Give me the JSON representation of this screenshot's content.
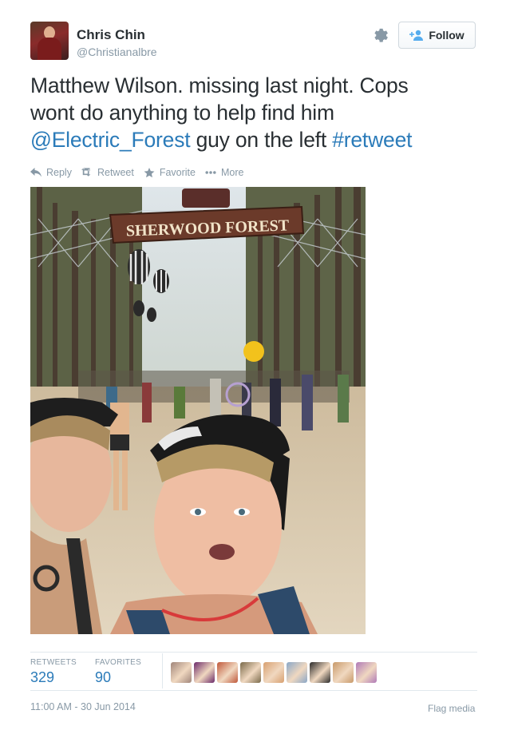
{
  "author": {
    "name": "Chris Chin",
    "handle": "@Christianalbre"
  },
  "follow_label": "Follow",
  "tweet": {
    "line1": "Matthew Wilson. missing last night. Cops",
    "line2": "wont do anything to help find him",
    "mention": "@Electric_Forest",
    "middle": " guy on the left ",
    "hashtag": "#retweet"
  },
  "actions": {
    "reply": "Reply",
    "retweet": "Retweet",
    "favorite": "Favorite",
    "more": "More"
  },
  "photo": {
    "sign_text": "SHERWOOD FOREST"
  },
  "stats": {
    "retweets_label": "RETWEETS",
    "retweets_value": "329",
    "favorites_label": "FAVORITES",
    "favorites_value": "90"
  },
  "favoriters": [
    {
      "name": "favoriter-1",
      "color": "#a0857a"
    },
    {
      "name": "favoriter-2",
      "color": "#6b2a6a"
    },
    {
      "name": "favoriter-3",
      "color": "#c0583a"
    },
    {
      "name": "favoriter-4",
      "color": "#7a6a4a"
    },
    {
      "name": "favoriter-5",
      "color": "#d8a070"
    },
    {
      "name": "favoriter-6",
      "color": "#8aa8c8"
    },
    {
      "name": "favoriter-7",
      "color": "#2a2a2a"
    },
    {
      "name": "favoriter-8",
      "color": "#c89a6a"
    },
    {
      "name": "favoriter-9",
      "color": "#b07ab8"
    }
  ],
  "timestamp": "11:00 AM - 30 Jun 2014",
  "flag_label": "Flag media",
  "colors": {
    "link": "#2b7bb9",
    "muted": "#8899a6",
    "text": "#292f33"
  },
  "icons": [
    "gear-icon",
    "follow-person-icon",
    "reply-icon",
    "retweet-icon",
    "favorite-star-icon",
    "more-dots-icon"
  ]
}
